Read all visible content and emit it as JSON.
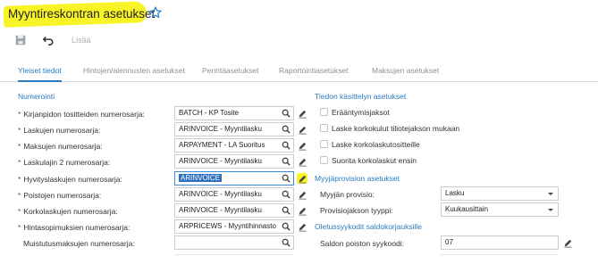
{
  "header": {
    "title": "Myyntireskontran asetukset",
    "star_icon": "star-outline-icon"
  },
  "toolbar": {
    "save_icon": "save-icon",
    "undo_icon": "undo-icon",
    "add_label": "Lisää"
  },
  "tabs": [
    {
      "label": "Yleiset tiedot",
      "active": true
    },
    {
      "label": "Hintojen/alennusten asetukset",
      "active": false
    },
    {
      "label": "Perintäasetukset",
      "active": false
    },
    {
      "label": "Raportointiasetukset",
      "active": false
    },
    {
      "label": "Maksujen asetukset",
      "active": false
    }
  ],
  "numerointi": {
    "heading": "Numerointi",
    "rows": [
      {
        "label": "Kirjanpidon tositteiden numerosarja:",
        "required": true,
        "value": "BATCH - KP Tosite"
      },
      {
        "label": "Laskujen numerosarja:",
        "required": true,
        "value": "ARINVOICE - Myyntilasku"
      },
      {
        "label": "Maksujen numerosarja:",
        "required": true,
        "value": "ARPAYMENT - LA Suoritus"
      },
      {
        "label": "Laskulajin 2 numerosarja:",
        "required": true,
        "value": "ARINVOICE - Myyntilasku"
      },
      {
        "label": "Hyvityslaskujen numerosarja:",
        "required": true,
        "value": "ARINVOICE"
      },
      {
        "label": "Poistojen numerosarja:",
        "required": true,
        "value": "ARINVOICE - Myyntilasku"
      },
      {
        "label": "Korkolaskujen numerosarja:",
        "required": true,
        "value": "ARINVOICE - Myyntilasku"
      },
      {
        "label": "Hintasopimuksien numerosarja:",
        "required": true,
        "value": "ARPRICEWS - Myyntihinnasto"
      },
      {
        "label": "Muistutusmaksujen numerosarja:",
        "required": false,
        "value": ""
      }
    ]
  },
  "tiedon_kasittely": {
    "heading": "Tiedon käsittelyn asetukset",
    "checkboxes": [
      {
        "label": "Erääntymisjaksot",
        "checked": false
      },
      {
        "label": "Laske korkokulut tiliotejakson mukaan",
        "checked": false
      },
      {
        "label": "Laske korkolaskutositteille",
        "checked": false
      },
      {
        "label": "Suorita korkolaskut ensin",
        "checked": false
      }
    ]
  },
  "myyjaprovisio": {
    "heading": "Myyjäprovision asetukset",
    "fields": [
      {
        "label": "Myyjän provisio:",
        "value": "Lasku"
      },
      {
        "label": "Provisiojakson tyyppi:",
        "value": "Kuukausittain"
      }
    ]
  },
  "oletussyykoodit": {
    "heading": "Oletussyykodit saldokorjauksille",
    "fields": [
      {
        "label": "Saldon poiston syykoodi:",
        "value": "07"
      }
    ]
  },
  "colors": {
    "accent": "#2a7bbf",
    "highlight": "#f8f428",
    "focus": "#2f6fc0"
  }
}
